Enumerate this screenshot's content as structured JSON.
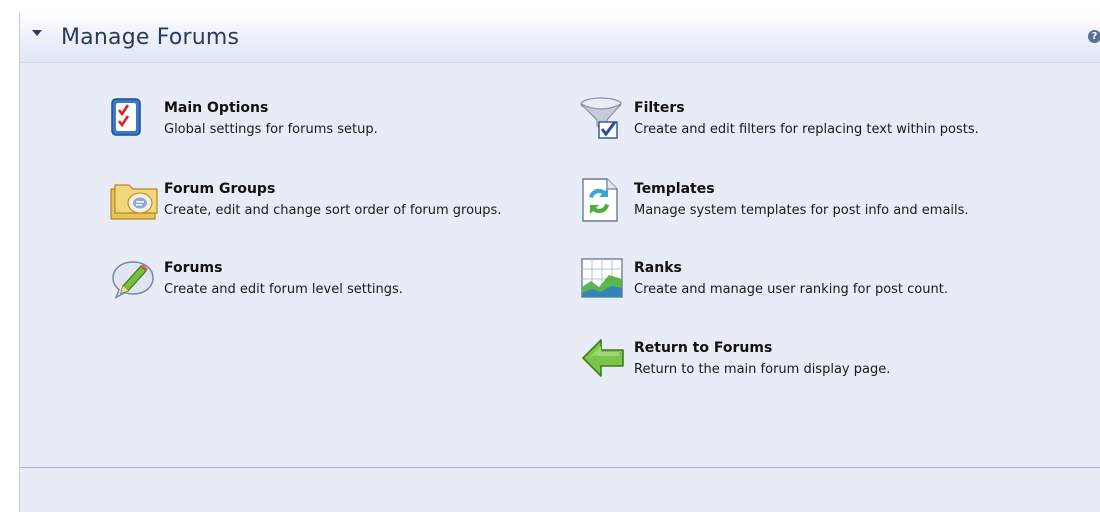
{
  "panel": {
    "title": "Manage Forums",
    "help_symbol": "?"
  },
  "items": [
    {
      "title": "Main Options",
      "desc": "Global settings for forums setup.",
      "icon": "checklist-icon"
    },
    {
      "title": "Forum Groups",
      "desc": "Create, edit and change sort order of forum groups.",
      "icon": "folders-icon"
    },
    {
      "title": "Forums",
      "desc": "Create and edit forum level settings.",
      "icon": "speech-bubble-pencil-icon"
    },
    {
      "title": "Filters",
      "desc": "Create and edit filters for replacing text within posts.",
      "icon": "funnel-check-icon"
    },
    {
      "title": "Templates",
      "desc": "Manage system templates for post info and emails.",
      "icon": "template-refresh-icon"
    },
    {
      "title": "Ranks",
      "desc": "Create and manage user ranking for post count.",
      "icon": "chart-icon"
    },
    {
      "title": "Return to Forums",
      "desc": "Return to the main forum display page.",
      "icon": "back-arrow-icon"
    }
  ]
}
